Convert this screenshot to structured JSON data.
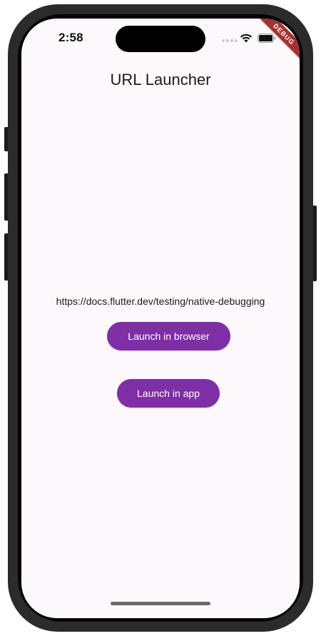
{
  "status_bar": {
    "time": "2:58",
    "icons": [
      "signal-dots-icon",
      "wifi-icon",
      "battery-icon"
    ]
  },
  "debug_banner": "DEBUG",
  "app_bar": {
    "title": "URL Launcher"
  },
  "content": {
    "url": "https://docs.flutter.dev/testing/native-debugging",
    "launch_browser_label": "Launch in browser",
    "launch_app_label": "Launch in app"
  },
  "colors": {
    "background": "#fcf8fc",
    "button": "#7f2fa5",
    "button_text": "#ffffff",
    "debug_banner": "#a3312f"
  }
}
